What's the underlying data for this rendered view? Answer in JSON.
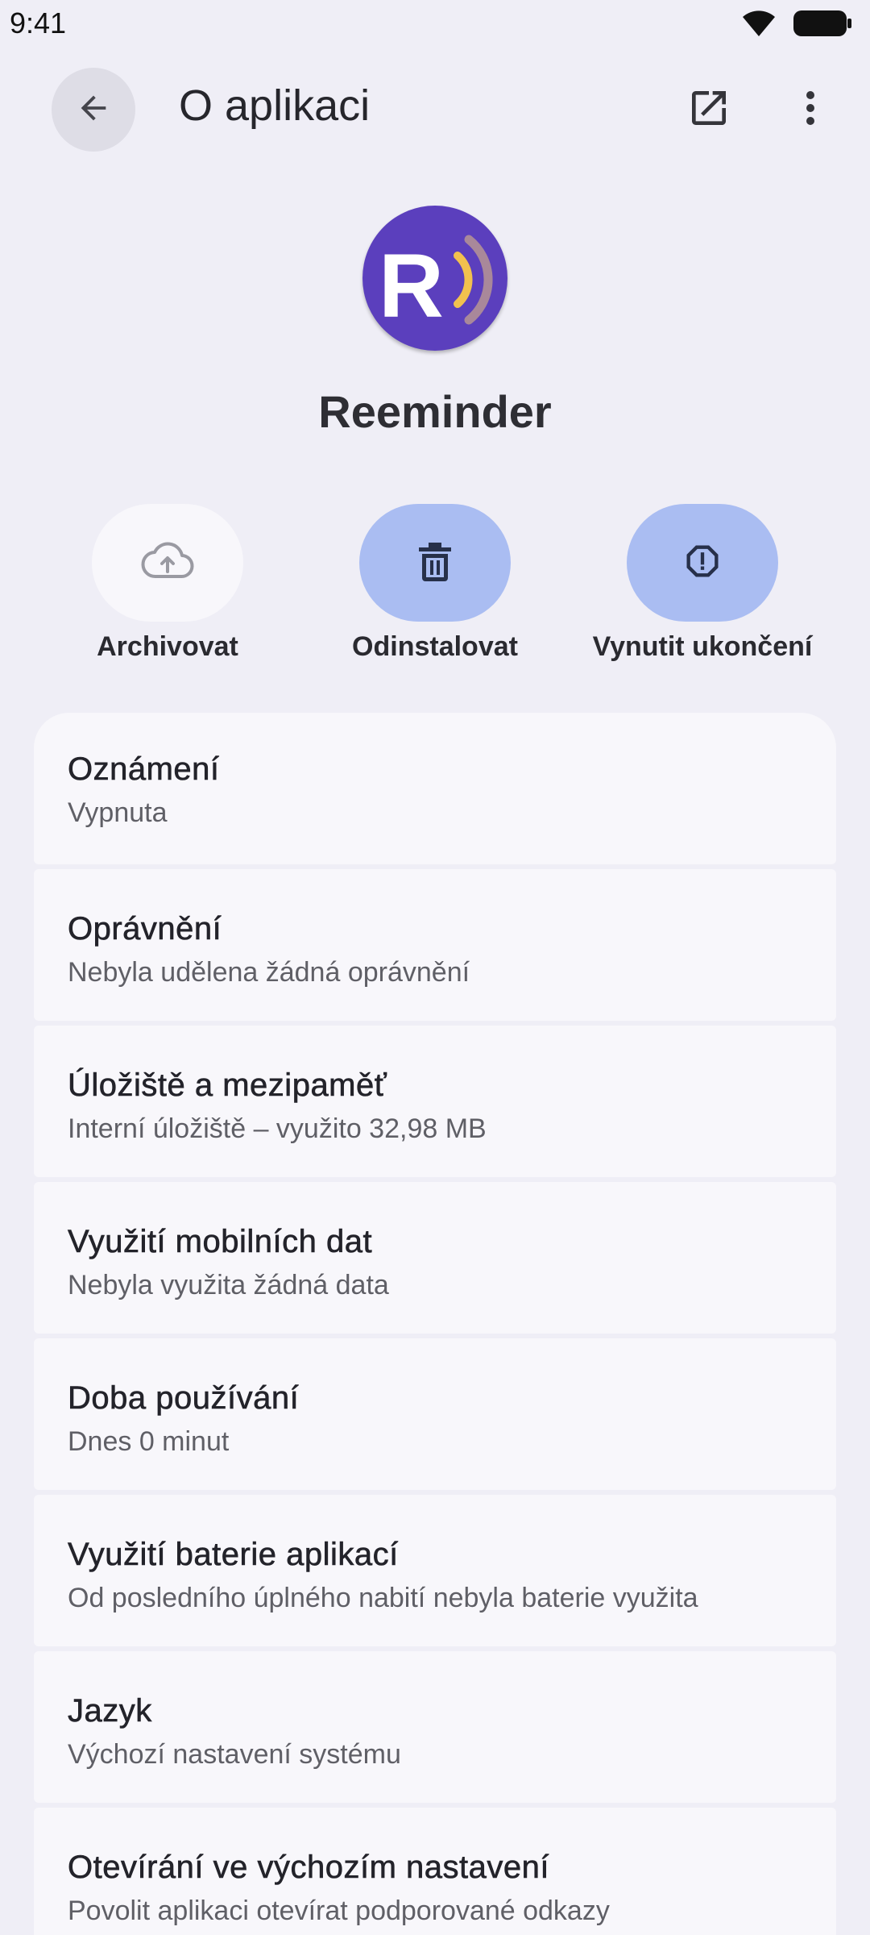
{
  "status_bar": {
    "time": "9:41"
  },
  "header": {
    "title": "O aplikaci"
  },
  "app": {
    "name": "Reeminder",
    "icon_letter": "R"
  },
  "actions": [
    {
      "label": "Archivovat",
      "icon": "cloud-upload-icon"
    },
    {
      "label": "Odinstalovat",
      "icon": "trash-icon"
    },
    {
      "label": "Vynutit ukončení",
      "icon": "alert-octagon-icon"
    }
  ],
  "settings": [
    {
      "title": "Oznámení",
      "subtitle": "Vypnuta"
    },
    {
      "title": "Oprávnění",
      "subtitle": "Nebyla udělena žádná oprávnění"
    },
    {
      "title": "Úložiště a mezipaměť",
      "subtitle": "Interní úložiště – využito 32,98 MB"
    },
    {
      "title": "Využití mobilních dat",
      "subtitle": "Nebyla využita žádná data"
    },
    {
      "title": "Doba používání",
      "subtitle": "Dnes 0 minut"
    },
    {
      "title": "Využití baterie aplikací",
      "subtitle": "Od posledního úplného nabití nebyla baterie využita"
    },
    {
      "title": "Jazyk",
      "subtitle": "Výchozí nastavení systému"
    },
    {
      "title": "Otevírání ve výchozím nastavení",
      "subtitle": "Povolit aplikaci otevírat podporované odkazy"
    }
  ],
  "colors": {
    "background": "#efeef6",
    "card": "#f8f7fb",
    "tonal": "#aabdf2",
    "icon_bg": "#5b3fbd",
    "icon_accent": "#f2c14e"
  }
}
